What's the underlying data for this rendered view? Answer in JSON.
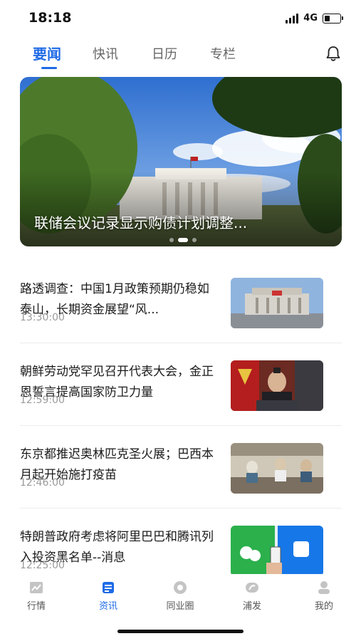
{
  "status": {
    "time": "18:18",
    "network": "4G",
    "battery_level": 0.35
  },
  "tabs": [
    {
      "label": "要闻",
      "active": true
    },
    {
      "label": "快讯",
      "active": false
    },
    {
      "label": "日历",
      "active": false
    },
    {
      "label": "专栏",
      "active": false
    }
  ],
  "header": {
    "bell_icon": "bell-icon"
  },
  "hero": {
    "title": "联储会议记录显示购债计划调整...",
    "slide_count": 3,
    "active_slide": 1
  },
  "news": [
    {
      "title": "路透调查：中国1月政策预期仍稳如泰山，长期资金展望“风...",
      "time": "13:30:00",
      "thumb": "bank-building-image"
    },
    {
      "title": "朝鲜劳动党罕见召开代表大会，金正恩誓言提高国家防卫力量",
      "time": "12:59:00",
      "thumb": "speaker-podium-image"
    },
    {
      "title": "东京都推迟奥林匹克圣火展；巴西本月起开始施打疫苗",
      "time": "12:46:00",
      "thumb": "vaccination-image"
    },
    {
      "title": "特朗普政府考虑将阿里巴巴和腾讯列入投资黑名单--消息",
      "time": "12:25:00",
      "thumb": "payment-sign-image"
    }
  ],
  "bottom_nav": [
    {
      "label": "行情",
      "icon": "chart-icon",
      "active": false
    },
    {
      "label": "资讯",
      "icon": "news-icon",
      "active": true
    },
    {
      "label": "同业圈",
      "icon": "circle-icon",
      "active": false
    },
    {
      "label": "浦发",
      "icon": "spdb-logo-icon",
      "active": false
    },
    {
      "label": "我的",
      "icon": "user-icon",
      "active": false
    }
  ],
  "colors": {
    "accent": "#1f6be6",
    "text": "#1a1a1a",
    "muted": "#9a9a9a"
  }
}
